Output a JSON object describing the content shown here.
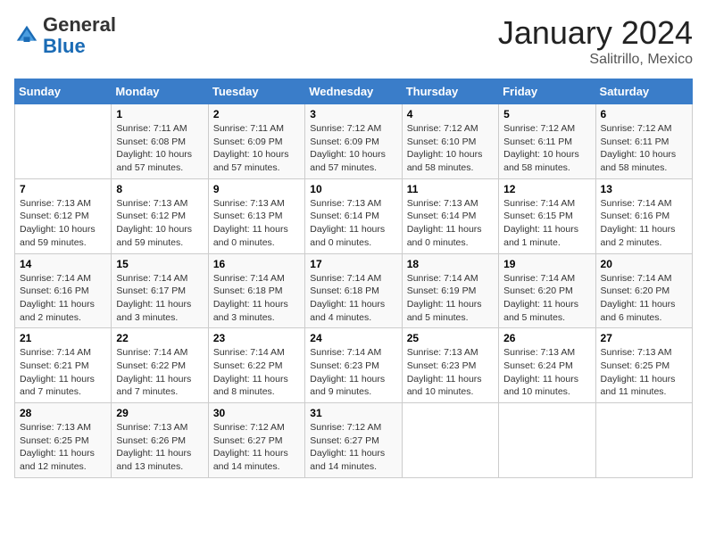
{
  "logo": {
    "general": "General",
    "blue": "Blue"
  },
  "title": "January 2024",
  "subtitle": "Salitrillo, Mexico",
  "days_of_week": [
    "Sunday",
    "Monday",
    "Tuesday",
    "Wednesday",
    "Thursday",
    "Friday",
    "Saturday"
  ],
  "weeks": [
    [
      {
        "day": "",
        "info": ""
      },
      {
        "day": "1",
        "info": "Sunrise: 7:11 AM\nSunset: 6:08 PM\nDaylight: 10 hours\nand 57 minutes."
      },
      {
        "day": "2",
        "info": "Sunrise: 7:11 AM\nSunset: 6:09 PM\nDaylight: 10 hours\nand 57 minutes."
      },
      {
        "day": "3",
        "info": "Sunrise: 7:12 AM\nSunset: 6:09 PM\nDaylight: 10 hours\nand 57 minutes."
      },
      {
        "day": "4",
        "info": "Sunrise: 7:12 AM\nSunset: 6:10 PM\nDaylight: 10 hours\nand 58 minutes."
      },
      {
        "day": "5",
        "info": "Sunrise: 7:12 AM\nSunset: 6:11 PM\nDaylight: 10 hours\nand 58 minutes."
      },
      {
        "day": "6",
        "info": "Sunrise: 7:12 AM\nSunset: 6:11 PM\nDaylight: 10 hours\nand 58 minutes."
      }
    ],
    [
      {
        "day": "7",
        "info": "Sunrise: 7:13 AM\nSunset: 6:12 PM\nDaylight: 10 hours\nand 59 minutes."
      },
      {
        "day": "8",
        "info": "Sunrise: 7:13 AM\nSunset: 6:12 PM\nDaylight: 10 hours\nand 59 minutes."
      },
      {
        "day": "9",
        "info": "Sunrise: 7:13 AM\nSunset: 6:13 PM\nDaylight: 11 hours\nand 0 minutes."
      },
      {
        "day": "10",
        "info": "Sunrise: 7:13 AM\nSunset: 6:14 PM\nDaylight: 11 hours\nand 0 minutes."
      },
      {
        "day": "11",
        "info": "Sunrise: 7:13 AM\nSunset: 6:14 PM\nDaylight: 11 hours\nand 0 minutes."
      },
      {
        "day": "12",
        "info": "Sunrise: 7:14 AM\nSunset: 6:15 PM\nDaylight: 11 hours\nand 1 minute."
      },
      {
        "day": "13",
        "info": "Sunrise: 7:14 AM\nSunset: 6:16 PM\nDaylight: 11 hours\nand 2 minutes."
      }
    ],
    [
      {
        "day": "14",
        "info": "Sunrise: 7:14 AM\nSunset: 6:16 PM\nDaylight: 11 hours\nand 2 minutes."
      },
      {
        "day": "15",
        "info": "Sunrise: 7:14 AM\nSunset: 6:17 PM\nDaylight: 11 hours\nand 3 minutes."
      },
      {
        "day": "16",
        "info": "Sunrise: 7:14 AM\nSunset: 6:18 PM\nDaylight: 11 hours\nand 3 minutes."
      },
      {
        "day": "17",
        "info": "Sunrise: 7:14 AM\nSunset: 6:18 PM\nDaylight: 11 hours\nand 4 minutes."
      },
      {
        "day": "18",
        "info": "Sunrise: 7:14 AM\nSunset: 6:19 PM\nDaylight: 11 hours\nand 5 minutes."
      },
      {
        "day": "19",
        "info": "Sunrise: 7:14 AM\nSunset: 6:20 PM\nDaylight: 11 hours\nand 5 minutes."
      },
      {
        "day": "20",
        "info": "Sunrise: 7:14 AM\nSunset: 6:20 PM\nDaylight: 11 hours\nand 6 minutes."
      }
    ],
    [
      {
        "day": "21",
        "info": "Sunrise: 7:14 AM\nSunset: 6:21 PM\nDaylight: 11 hours\nand 7 minutes."
      },
      {
        "day": "22",
        "info": "Sunrise: 7:14 AM\nSunset: 6:22 PM\nDaylight: 11 hours\nand 7 minutes."
      },
      {
        "day": "23",
        "info": "Sunrise: 7:14 AM\nSunset: 6:22 PM\nDaylight: 11 hours\nand 8 minutes."
      },
      {
        "day": "24",
        "info": "Sunrise: 7:14 AM\nSunset: 6:23 PM\nDaylight: 11 hours\nand 9 minutes."
      },
      {
        "day": "25",
        "info": "Sunrise: 7:13 AM\nSunset: 6:23 PM\nDaylight: 11 hours\nand 10 minutes."
      },
      {
        "day": "26",
        "info": "Sunrise: 7:13 AM\nSunset: 6:24 PM\nDaylight: 11 hours\nand 10 minutes."
      },
      {
        "day": "27",
        "info": "Sunrise: 7:13 AM\nSunset: 6:25 PM\nDaylight: 11 hours\nand 11 minutes."
      }
    ],
    [
      {
        "day": "28",
        "info": "Sunrise: 7:13 AM\nSunset: 6:25 PM\nDaylight: 11 hours\nand 12 minutes."
      },
      {
        "day": "29",
        "info": "Sunrise: 7:13 AM\nSunset: 6:26 PM\nDaylight: 11 hours\nand 13 minutes."
      },
      {
        "day": "30",
        "info": "Sunrise: 7:12 AM\nSunset: 6:27 PM\nDaylight: 11 hours\nand 14 minutes."
      },
      {
        "day": "31",
        "info": "Sunrise: 7:12 AM\nSunset: 6:27 PM\nDaylight: 11 hours\nand 14 minutes."
      },
      {
        "day": "",
        "info": ""
      },
      {
        "day": "",
        "info": ""
      },
      {
        "day": "",
        "info": ""
      }
    ]
  ]
}
